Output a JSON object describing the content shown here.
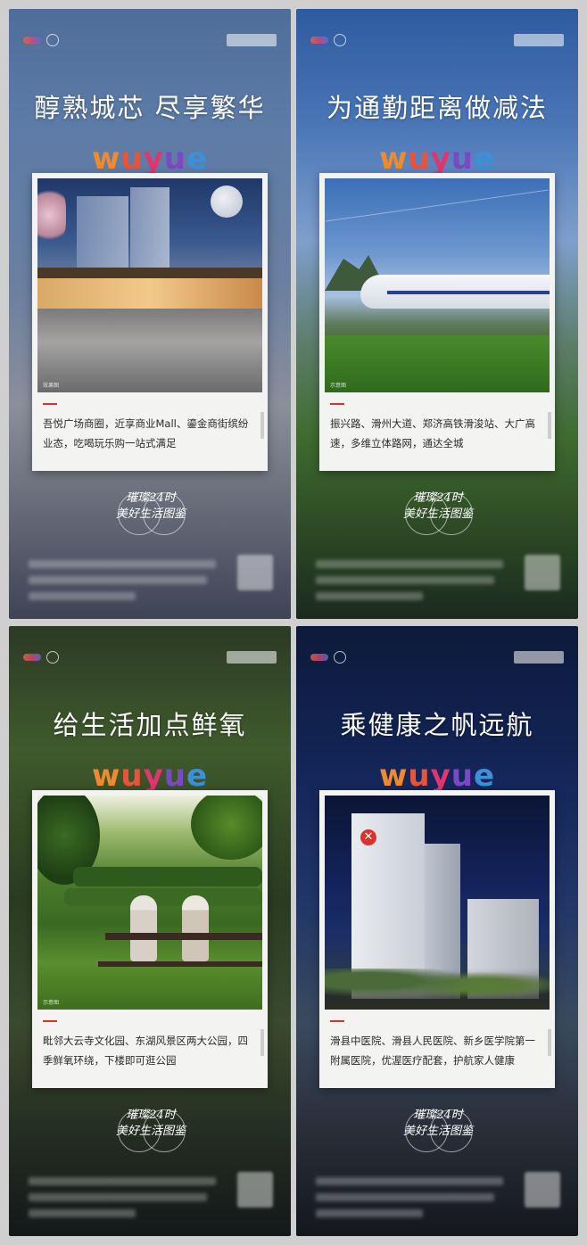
{
  "logo_text": "wuyue",
  "slogan": {
    "line1": "璀璨24时",
    "line2": "美好生活图鉴"
  },
  "posters": [
    {
      "headline": "醇熟城芯 尽享繁华",
      "photo_caption": "效果图",
      "photo_icon": "mall-photo",
      "description": "吾悦广场商圈，近享商业Mall、鎏金商街缤纷业态，吃喝玩乐购一站式满足"
    },
    {
      "headline": "为通勤距离做减法",
      "photo_caption": "示意图",
      "photo_icon": "train-photo",
      "description": "振兴路、滑州大道、郑济高铁滑浚站、大广高速，多维立体路网，通达全城"
    },
    {
      "headline": "给生活加点鲜氧",
      "photo_caption": "示意图",
      "photo_icon": "park-photo",
      "description": "毗邻大云寺文化园、东湖风景区两大公园，四季鲜氧环绕，下楼即可逛公园"
    },
    {
      "headline": "乘健康之帆远航",
      "photo_caption": "",
      "photo_icon": "hospital-photo",
      "description": "滑县中医院、滑县人民医院、新乡医学院第一附属医院，优渥医疗配套，护航家人健康"
    }
  ],
  "colors": {
    "accent_red": "#d9322c",
    "logo_w": "#f08a2c",
    "logo_u1": "#e8533a",
    "logo_y": "#e0356f",
    "logo_u2": "#7b4ac2",
    "logo_e": "#3d8fd6"
  }
}
